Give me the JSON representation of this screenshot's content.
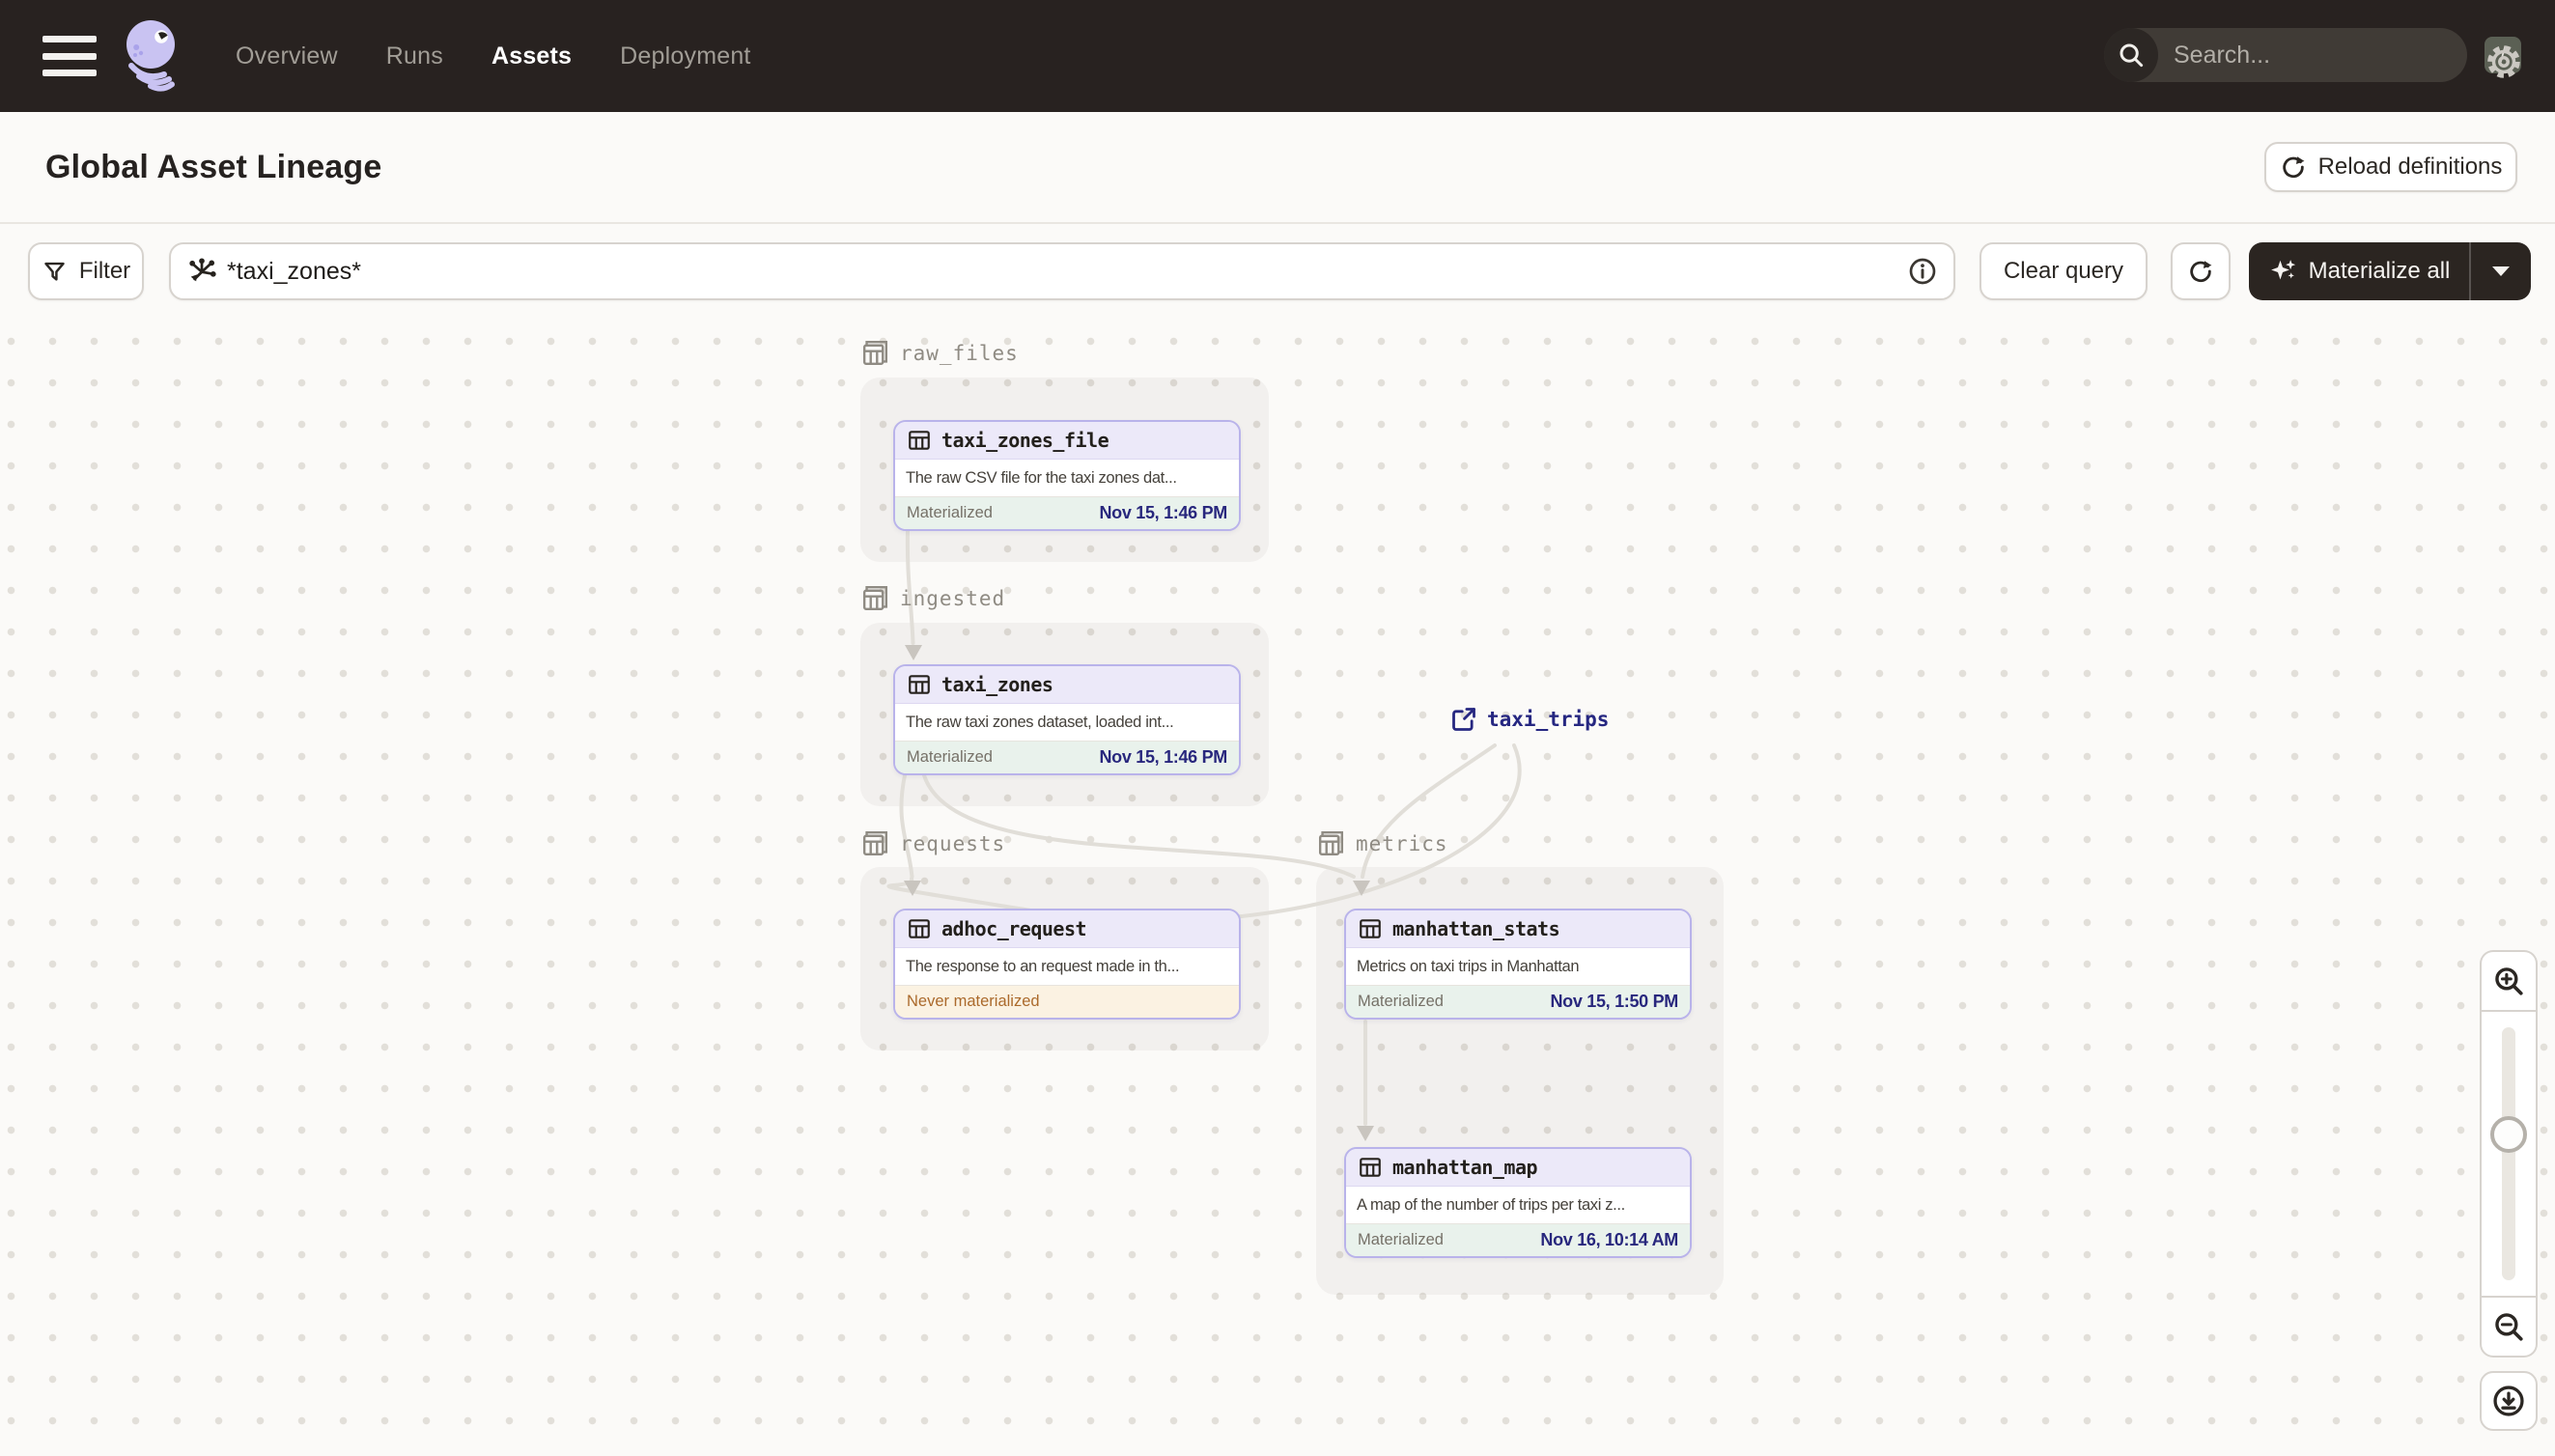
{
  "nav": {
    "items": [
      "Overview",
      "Runs",
      "Assets",
      "Deployment"
    ],
    "active_item": "Assets",
    "search_placeholder": "Search...",
    "search_shortcut": "/"
  },
  "header": {
    "title": "Global Asset Lineage",
    "reload_button": "Reload definitions"
  },
  "toolbar": {
    "filter_button": "Filter",
    "query_value": "*taxi_zones*",
    "clear_button": "Clear query",
    "materialize_button": "Materialize all"
  },
  "graph": {
    "groups": {
      "raw_files": {
        "label": "raw_files"
      },
      "ingested": {
        "label": "ingested"
      },
      "requests": {
        "label": "requests"
      },
      "metrics": {
        "label": "metrics"
      }
    },
    "nodes": {
      "taxi_zones_file": {
        "name": "taxi_zones_file",
        "description": "The raw CSV file for the taxi zones dat...",
        "status": "Materialized",
        "timestamp": "Nov 15, 1:46 PM"
      },
      "taxi_zones": {
        "name": "taxi_zones",
        "description": "The raw taxi zones dataset, loaded int...",
        "status": "Materialized",
        "timestamp": "Nov 15, 1:46 PM"
      },
      "adhoc_request": {
        "name": "adhoc_request",
        "description": "The response to an request made in th...",
        "status": "Never materialized"
      },
      "manhattan_stats": {
        "name": "manhattan_stats",
        "description": "Metrics on taxi trips in Manhattan",
        "status": "Materialized",
        "timestamp": "Nov 15, 1:50 PM"
      },
      "manhattan_map": {
        "name": "manhattan_map",
        "description": "A map of the number of trips per taxi z...",
        "status": "Materialized",
        "timestamp": "Nov 16, 10:14 AM"
      }
    },
    "external_assets": {
      "taxi_trips": {
        "name": "taxi_trips"
      }
    }
  },
  "colors": {
    "topbar_bg": "#282220",
    "page_bg": "#fbfaf8",
    "node_border": "#b9b3ea",
    "node_header_bg": "#ece9f9",
    "materialized_bg": "#e9f2ec",
    "materialized_time_text": "#28277d",
    "never_materialized_bg": "#fbf2e2",
    "never_materialized_text": "#ab6a2c",
    "edge": "#e1ded8",
    "group_label_text": "#8f8b83",
    "dark_button_bg": "#2b2521"
  }
}
